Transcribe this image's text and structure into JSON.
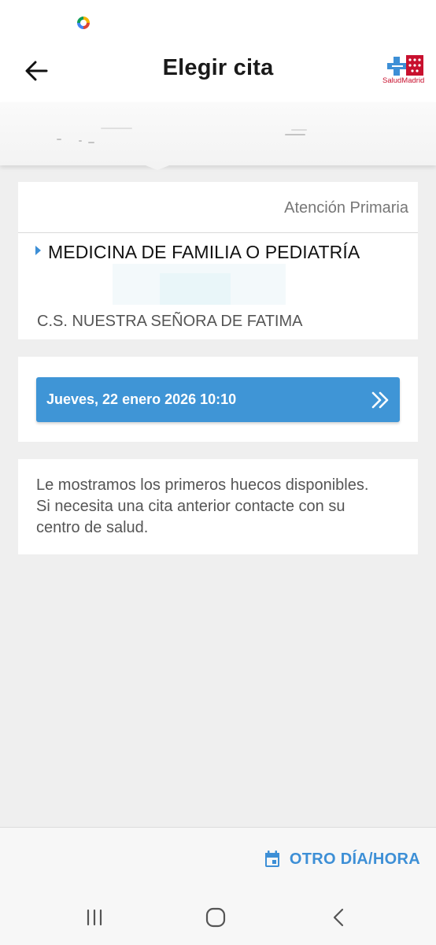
{
  "app_bar": {
    "title": "Elegir cita",
    "logo_text": "SaludMadrid",
    "back_icon": "arrow-left-icon"
  },
  "service_card": {
    "area": "Atención Primaria",
    "specialty": "MEDICINA DE FAMILIA O PEDIATRÍA",
    "centre": "C.S. NUESTRA SEÑORA DE FATIMA"
  },
  "slot": {
    "label": "Jueves, 22 enero 2026 10:10",
    "icon": "double-chevron-right-icon"
  },
  "info": {
    "text": "Le mostramos los primeros huecos disponibles. Si necesita una cita anterior contacte con su centro de salud."
  },
  "footer": {
    "other_date_label": "OTRO DÍA/HORA",
    "icon": "calendar-icon"
  },
  "colors": {
    "accent": "#3f95d6",
    "logo_red": "#c8102e",
    "logo_blue": "#3d8fd6"
  }
}
